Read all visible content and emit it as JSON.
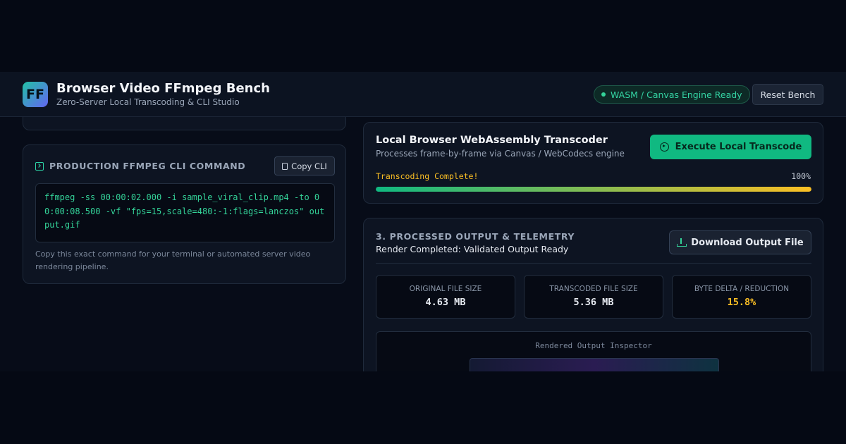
{
  "header": {
    "logo_text": "FF",
    "title": "Browser Video FFmpeg Bench",
    "subtitle": "Zero-Server Local Transcoding & CLI Studio",
    "engine_status": "WASM / Canvas Engine Ready",
    "reset_label": "Reset Bench"
  },
  "cli": {
    "heading": "PRODUCTION FFMPEG CLI COMMAND",
    "copy_label": "Copy CLI",
    "command": "ffmpeg -ss 00:00:02.000 -i sample_viral_clip.mp4 -to 00:00:08.500 -vf \"fps=15,scale=480:-1:flags=lanczos\" output.gif",
    "note": "Copy this exact command for your terminal or automated server video rendering pipeline."
  },
  "transcoder": {
    "title": "Local Browser WebAssembly Transcoder",
    "subtitle": "Processes frame-by-frame via Canvas / WebCodecs engine",
    "execute_label": "Execute Local Transcode",
    "status": "Transcoding Complete!",
    "progress_label": "100%",
    "progress": 1.0
  },
  "output": {
    "title": "3. PROCESSED OUTPUT & TELEMETRY",
    "subtitle": "Render Completed: Validated Output Ready",
    "download_label": "Download Output File",
    "stats": [
      {
        "label": "ORIGINAL FILE SIZE",
        "value": "4.63 MB"
      },
      {
        "label": "TRANSCODED FILE SIZE",
        "value": "5.36 MB"
      },
      {
        "label": "BYTE DELTA / REDUCTION",
        "value": "15.8%"
      }
    ],
    "inspector_label": "Rendered Output Inspector"
  },
  "colors": {
    "accent": "#10b981",
    "warning": "#fbbf24",
    "background": "#050914"
  }
}
